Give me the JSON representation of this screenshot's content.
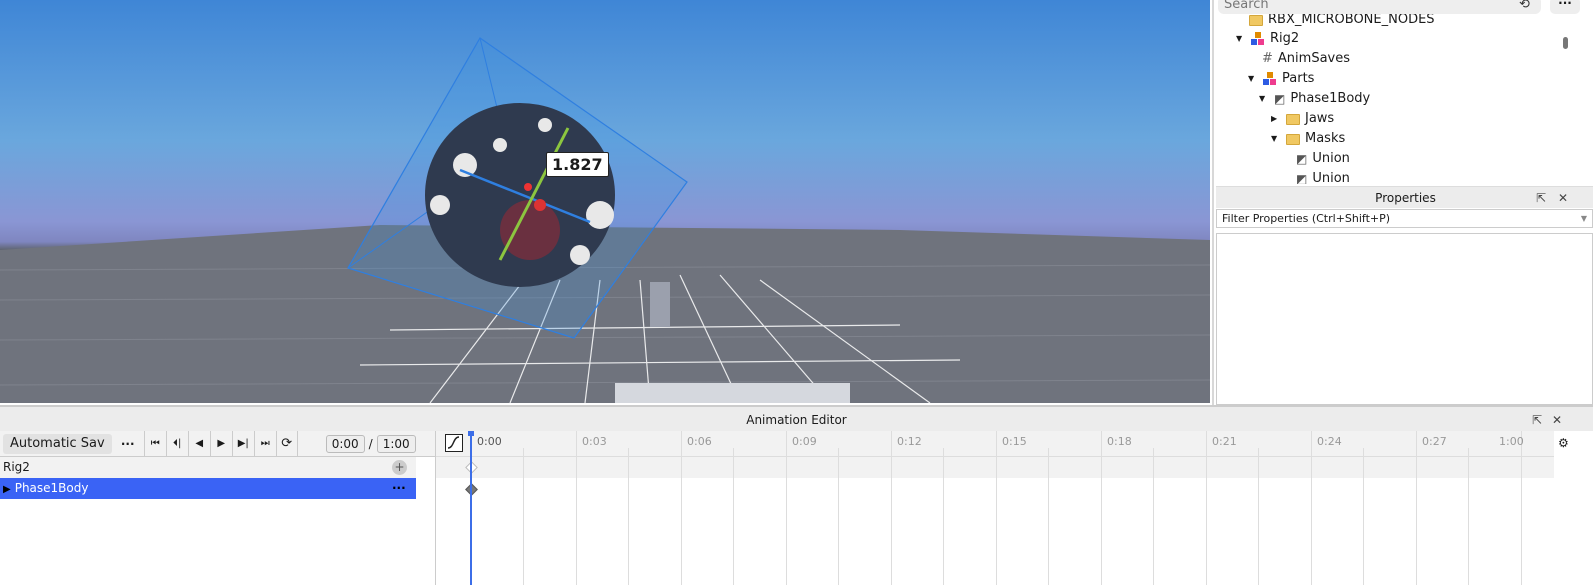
{
  "viewport": {
    "measure_label": "1.827"
  },
  "explorer": {
    "search_placeholder": "Search",
    "more_label": "···",
    "items": [
      {
        "label": "RBX_MICROBONE_NODES",
        "icon": "folder-icon"
      },
      {
        "label": "Rig2",
        "icon": "model-icon",
        "expanded": true
      },
      {
        "label": "AnimSaves",
        "icon": "hash-icon"
      },
      {
        "label": "Parts",
        "icon": "model-icon",
        "expanded": true
      },
      {
        "label": "Phase1Body",
        "icon": "union-icon",
        "expanded": true
      },
      {
        "label": "Jaws",
        "icon": "folder-icon",
        "expanded": false
      },
      {
        "label": "Masks",
        "icon": "folder-icon",
        "expanded": true
      },
      {
        "label": "Union",
        "icon": "union-icon"
      },
      {
        "label": "Union",
        "icon": "union-icon"
      }
    ]
  },
  "properties": {
    "title": "Properties",
    "filter_placeholder": "Filter Properties (Ctrl+Shift+P)"
  },
  "animation_editor": {
    "title": "Animation Editor",
    "save_mode": "Automatic Sav",
    "more": "···",
    "current_time": "0:00",
    "separator": "/",
    "end_time": "1:00",
    "tracks": [
      {
        "label": "Rig2",
        "add": "+"
      },
      {
        "label": "Phase1Body",
        "more": "···",
        "selected": true
      }
    ],
    "timeline_labels": [
      "0:00",
      "0:03",
      "0:06",
      "0:09",
      "0:12",
      "0:15",
      "0:18",
      "0:21",
      "0:24",
      "0:27",
      "1:00"
    ]
  },
  "colors": {
    "selection": "#3a63f5",
    "playhead": "#3c6ee8"
  }
}
